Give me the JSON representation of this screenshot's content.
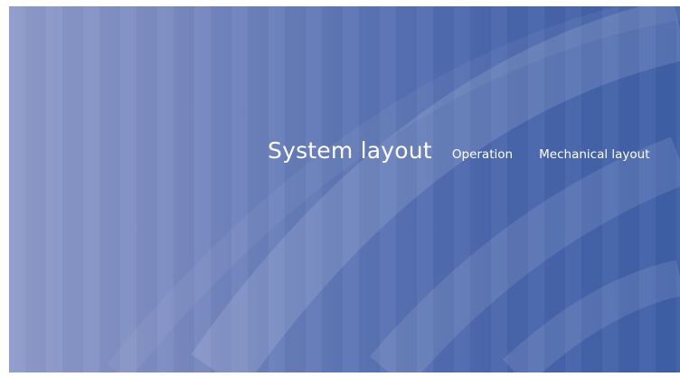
{
  "colors": {
    "panel_left": "#8e9bcb",
    "panel_right": "#3e5fa7",
    "text": "#ffffff"
  },
  "nav": {
    "active": "System layout",
    "items": [
      "Operation",
      "Mechanical layout"
    ]
  }
}
